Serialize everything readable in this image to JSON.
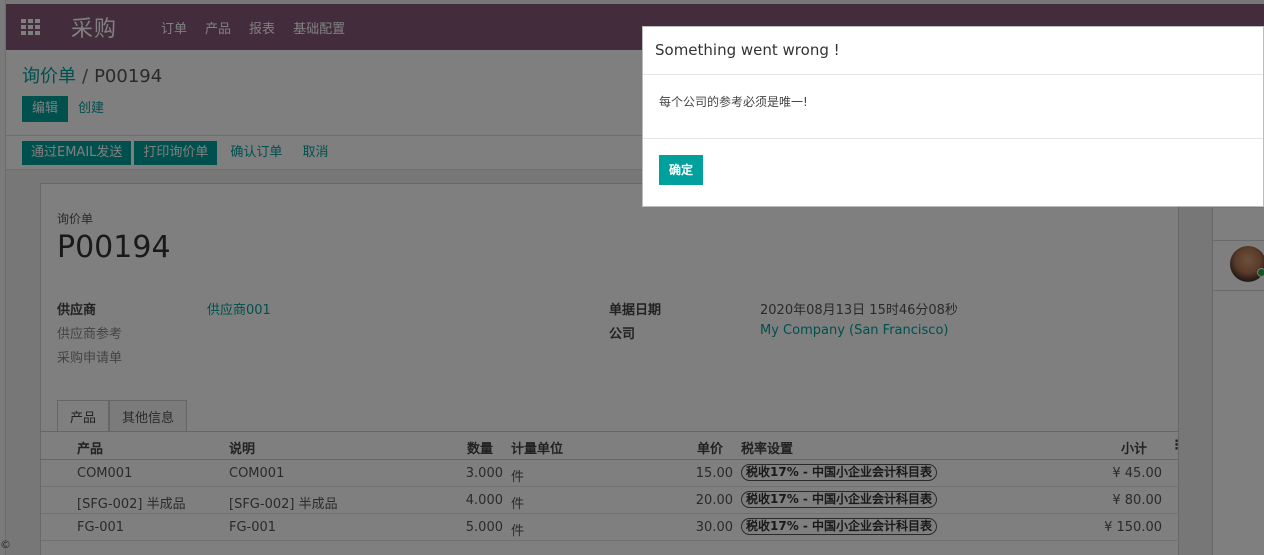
{
  "navbar": {
    "app_title": "采购",
    "menu": [
      "订单",
      "产品",
      "报表",
      "基础配置"
    ]
  },
  "breadcrumb": {
    "parent": "询价单",
    "separator": "/",
    "current": "P00194"
  },
  "buttons": {
    "edit": "编辑",
    "create": "创建"
  },
  "statusbar": {
    "send_email": "通过EMAIL发送",
    "print_rfq": "打印询价单",
    "confirm_order": "确认订单",
    "cancel": "取消"
  },
  "form": {
    "doc_type_label": "询价单",
    "doc_name": "P00194",
    "vendor_label": "供应商",
    "vendor_value": "供应商001",
    "vendor_ref_label": "供应商参考",
    "requisition_label": "采购申请单",
    "order_date_label": "单据日期",
    "order_date_value": "2020年08月13日 15时46分08秒",
    "company_label": "公司",
    "company_value": "My Company (San Francisco)"
  },
  "tabs": [
    "产品",
    "其他信息"
  ],
  "lines": {
    "headers": {
      "product": "产品",
      "description": "说明",
      "qty": "数量",
      "uom": "计量单位",
      "price": "单价",
      "taxes": "税率设置",
      "subtotal": "小计"
    },
    "rows": [
      {
        "product": "COM001",
        "description": "COM001",
        "qty": "3.000",
        "uom": "件",
        "price": "15.00",
        "tax": "税收17% - 中国小企业会计科目表",
        "subtotal": "¥ 45.00"
      },
      {
        "product": "[SFG-002] 半成品",
        "description": "[SFG-002] 半成品",
        "qty": "4.000",
        "uom": "件",
        "price": "20.00",
        "tax": "税收17% - 中国小企业会计科目表",
        "subtotal": "¥ 80.00"
      },
      {
        "product": "FG-001",
        "description": "FG-001",
        "qty": "5.000",
        "uom": "件",
        "price": "30.00",
        "tax": "税收17% - 中国小企业会计科目表",
        "subtotal": "¥ 150.00"
      }
    ]
  },
  "dialog": {
    "title": "Something went wrong !",
    "message": "每个公司的参考必须是唯一!",
    "ok_label": "确定"
  },
  "colors": {
    "navbar": "#875a7b",
    "accent": "#00a09d"
  },
  "icons": [
    "apps-grid-icon",
    "kebab-menu-icon",
    "user-avatar"
  ],
  "corner_glyph": "©"
}
